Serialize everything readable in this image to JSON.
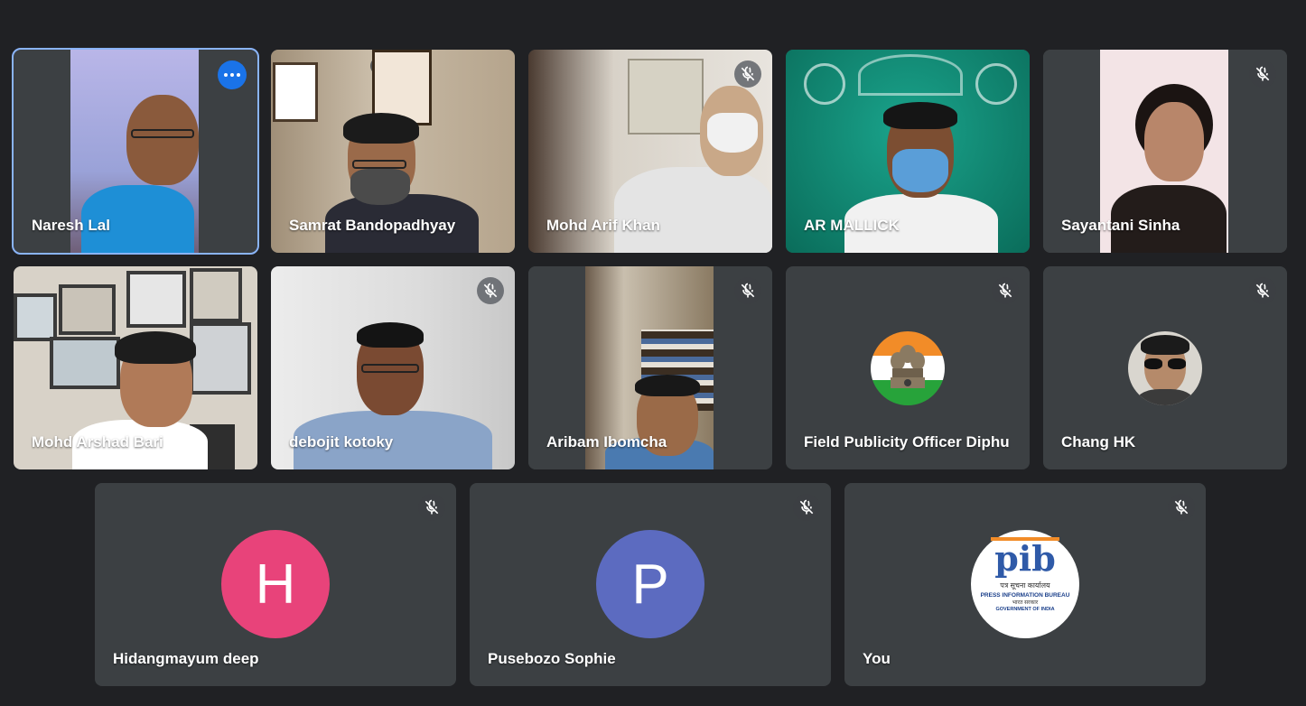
{
  "participants": [
    {
      "name": "Naresh Lal",
      "active_speaker": true,
      "muted": false
    },
    {
      "name": "Samrat Bandopadhyay",
      "muted": false
    },
    {
      "name": "Mohd Arif Khan",
      "muted": true
    },
    {
      "name": "AR MALLICK",
      "muted": false
    },
    {
      "name": "Sayantani Sinha",
      "muted": true
    },
    {
      "name": "Mohd Arshad Bari",
      "muted": false
    },
    {
      "name": "debojit kotoky",
      "muted": true
    },
    {
      "name": "Aribam Ibomcha",
      "muted": true
    },
    {
      "name": "Field Publicity Officer Diphu",
      "muted": true,
      "avatar": "emblem"
    },
    {
      "name": "Chang HK",
      "muted": true,
      "avatar": "photo"
    },
    {
      "name": "Hidangmayum deep",
      "muted": true,
      "avatar_letter": "H",
      "avatar_color": "#e8437a"
    },
    {
      "name": "Pusebozo Sophie",
      "muted": true,
      "avatar_letter": "P",
      "avatar_color": "#5c6bc0"
    },
    {
      "name": "You",
      "muted": true,
      "avatar": "pib-logo"
    }
  ],
  "pib_logo": {
    "mark": "pib",
    "hindi": "पत्र सूचना कार्यालय",
    "english": "PRESS INFORMATION BUREAU",
    "sub_hindi": "भारत सरकार",
    "sub_english": "GOVERNMENT OF INDIA"
  },
  "colors": {
    "background": "#202124",
    "tile": "#3c4043",
    "active_border": "#8ab4f8",
    "more_button": "#1a73e8"
  }
}
